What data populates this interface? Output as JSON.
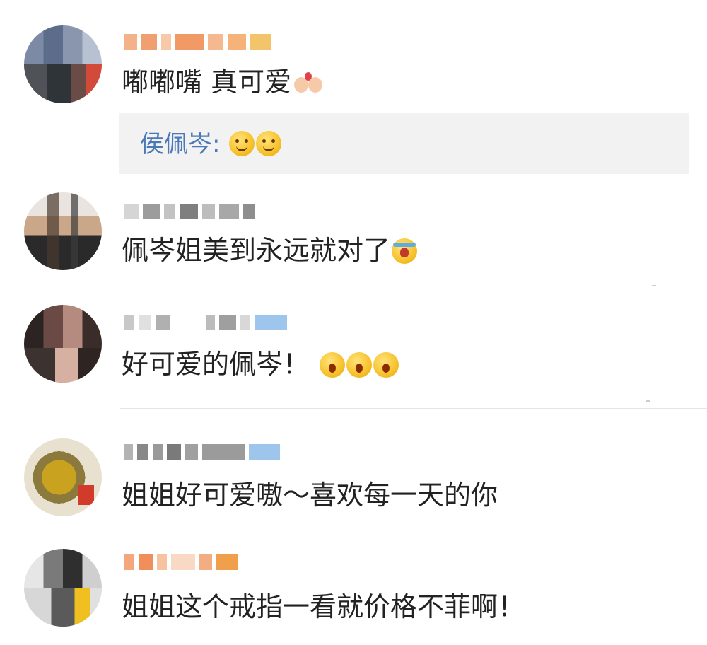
{
  "comments": [
    {
      "avatar_icon": "avatar-pixelated",
      "text": "嘟嘟嘴 真可爱",
      "emoji": [
        "couple-emoji"
      ],
      "reply": {
        "author": "侯佩岑",
        "separator": ":",
        "emoji": [
          "smile-emoji",
          "smile-emoji"
        ]
      }
    },
    {
      "avatar_icon": "avatar-pixelated",
      "text": "佩岑姐美到永远就对了",
      "emoji": [
        "cry-emoji"
      ]
    },
    {
      "avatar_icon": "avatar-pixelated",
      "text": "好可爱的佩岑！",
      "emoji": [
        "scream-emoji",
        "scream-emoji",
        "scream-emoji"
      ]
    },
    {
      "avatar_icon": "avatar-pixelated",
      "text": "姐姐好可爱嗷～喜欢每一天的你",
      "emoji": []
    },
    {
      "avatar_icon": "avatar-pixelated",
      "text": "姐姐这个戒指一看就价格不菲啊！",
      "emoji": []
    }
  ],
  "colors": {
    "reply_author": "#4b79b8",
    "reply_bg": "#f2f2f2",
    "text": "#222222"
  }
}
